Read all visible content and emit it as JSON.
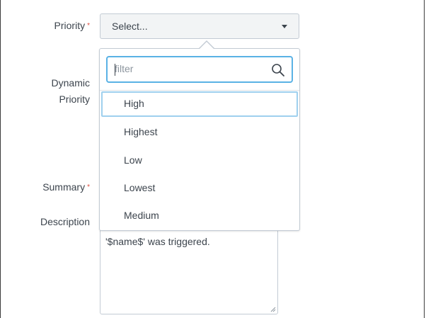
{
  "form": {
    "priority": {
      "label": "Priority",
      "required_mark": "*",
      "selected_value": "Select..."
    },
    "dynamic_priority": {
      "label_line1": "Dynamic",
      "label_line2": "Priority"
    },
    "summary": {
      "label": "Summary",
      "required_mark": "*"
    },
    "description": {
      "label": "Description",
      "value": "'$name$' was triggered."
    }
  },
  "dropdown": {
    "filter_placeholder": "filter",
    "options": [
      {
        "label": "High",
        "active": true
      },
      {
        "label": "Highest",
        "active": false
      },
      {
        "label": "Low",
        "active": false
      },
      {
        "label": "Lowest",
        "active": false
      },
      {
        "label": "Medium",
        "active": false
      }
    ]
  },
  "colors": {
    "required": "#dc4e41",
    "focus": "#5ab2e5",
    "active_option_border": "#9fd0ee",
    "text": "#3c444d"
  },
  "icons": {
    "filter_search": "search-icon",
    "select_caret": "caret-down-icon",
    "textarea_resize": "resize-grip-icon"
  }
}
